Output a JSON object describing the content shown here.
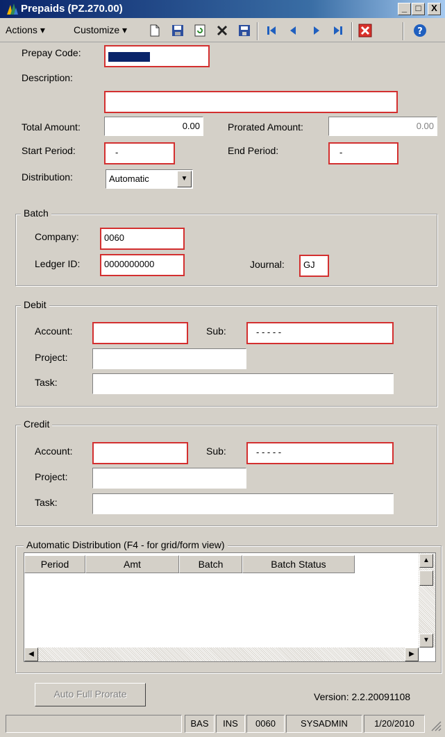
{
  "window": {
    "title": "Prepaids (PZ.270.00)",
    "minimize": "_",
    "maximize": "□",
    "close": "X"
  },
  "menu": {
    "actions": "Actions",
    "customize": "Customize"
  },
  "form": {
    "prepay_code_label": "Prepay Code:",
    "description_label": "Description:",
    "total_amount_label": "Total Amount:",
    "total_amount_value": "0.00",
    "prorated_amount_label": "Prorated Amount:",
    "prorated_amount_value": "0.00",
    "start_period_label": "Start Period:",
    "start_period_value": "-",
    "end_period_label": "End Period:",
    "end_period_value": "-",
    "distribution_label": "Distribution:",
    "distribution_value": "Automatic"
  },
  "batch": {
    "title": "Batch",
    "company_label": "Company:",
    "company_value": "0060",
    "ledger_label": "Ledger ID:",
    "ledger_value": "0000000000",
    "journal_label": "Journal:",
    "journal_value": "GJ"
  },
  "debit": {
    "title": "Debit",
    "account_label": "Account:",
    "sub_label": "Sub:",
    "sub_value": "-  -  -  -  -",
    "project_label": "Project:",
    "task_label": "Task:"
  },
  "credit": {
    "title": "Credit",
    "account_label": "Account:",
    "sub_label": "Sub:",
    "sub_value": "-  -  -  -  -",
    "project_label": "Project:",
    "task_label": "Task:"
  },
  "distribution_grid": {
    "title": "Automatic Distribution (F4 - for grid/form view)",
    "columns": [
      "Period",
      "Amt",
      "Batch",
      "Batch Status"
    ]
  },
  "footer": {
    "auto_prorate_label": "Auto Full Prorate",
    "version": "Version: 2.2.20091108"
  },
  "statusbar": {
    "cells": [
      "BAS",
      "INS",
      "0060",
      "SYSADMIN",
      "1/20/2010"
    ]
  }
}
